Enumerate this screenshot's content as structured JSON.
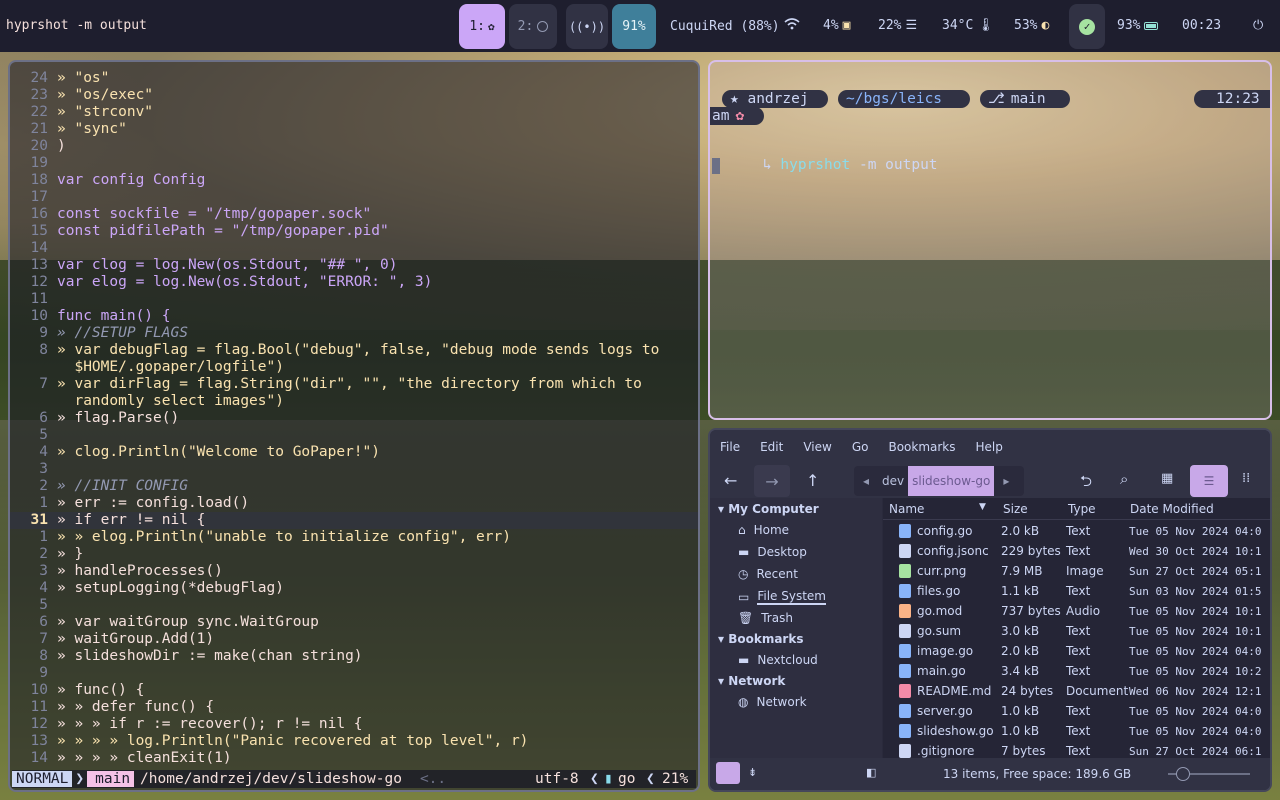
{
  "topbar": {
    "window_title": "hyprshot -m output",
    "ws1": "1:",
    "ws2": "2:",
    "volume": "91%",
    "wifi": "CuquiRed (88%)",
    "cpu": "4%",
    "mem": "22%",
    "temp": "34°C",
    "brightness": "53%",
    "battery": "93%",
    "clock": "00:23"
  },
  "editor": {
    "lines": [
      {
        "n": "24",
        "t": "» \"os\""
      },
      {
        "n": "23",
        "t": "» \"os/exec\""
      },
      {
        "n": "22",
        "t": "» \"strconv\""
      },
      {
        "n": "21",
        "t": "» \"sync\""
      },
      {
        "n": "20",
        "t": ")"
      },
      {
        "n": "19",
        "t": ""
      },
      {
        "n": "18",
        "t": "var config Config"
      },
      {
        "n": "17",
        "t": ""
      },
      {
        "n": "16",
        "t": "const sockfile = \"/tmp/gopaper.sock\""
      },
      {
        "n": "15",
        "t": "const pidfilePath = \"/tmp/gopaper.pid\""
      },
      {
        "n": "14",
        "t": ""
      },
      {
        "n": "13",
        "t": "var clog = log.New(os.Stdout, \"## \", 0)"
      },
      {
        "n": "12",
        "t": "var elog = log.New(os.Stdout, \"ERROR: \", 3)"
      },
      {
        "n": "11",
        "t": ""
      },
      {
        "n": "10",
        "t": "func main() {"
      },
      {
        "n": "9",
        "t": "» //SETUP FLAGS"
      },
      {
        "n": "8",
        "t": "» var debugFlag = flag.Bool(\"debug\", false, \"debug mode sends logs to"
      },
      {
        "n": "",
        "t": "  $HOME/.gopaper/logfile\")"
      },
      {
        "n": "7",
        "t": "» var dirFlag = flag.String(\"dir\", \"\", \"the directory from which to"
      },
      {
        "n": "",
        "t": "  randomly select images\")"
      },
      {
        "n": "6",
        "t": "» flag.Parse()"
      },
      {
        "n": "5",
        "t": ""
      },
      {
        "n": "4",
        "t": "» clog.Println(\"Welcome to GoPaper!\")"
      },
      {
        "n": "3",
        "t": ""
      },
      {
        "n": "2",
        "t": "» //INIT CONFIG"
      },
      {
        "n": "1",
        "t": "» err := config.load()"
      },
      {
        "n": "31",
        "t": "» if err != nil {"
      },
      {
        "n": "1",
        "t": "» » elog.Println(\"unable to initialize config\", err)"
      },
      {
        "n": "2",
        "t": "» }"
      },
      {
        "n": "3",
        "t": "» handleProcesses()"
      },
      {
        "n": "4",
        "t": "» setupLogging(*debugFlag)"
      },
      {
        "n": "5",
        "t": ""
      },
      {
        "n": "6",
        "t": "» var waitGroup sync.WaitGroup"
      },
      {
        "n": "7",
        "t": "» waitGroup.Add(1)"
      },
      {
        "n": "8",
        "t": "» slideshowDir := make(chan string)"
      },
      {
        "n": "9",
        "t": ""
      },
      {
        "n": "10",
        "t": "» func() {"
      },
      {
        "n": "11",
        "t": "» » defer func() {"
      },
      {
        "n": "12",
        "t": "» » » if r := recover(); r != nil {"
      },
      {
        "n": "13",
        "t": "» » » » log.Println(\"Panic recovered at top level\", r)"
      },
      {
        "n": "14",
        "t": "» » » » cleanExit(1)"
      }
    ],
    "status": {
      "mode": "NORMAL",
      "branch": "main",
      "path": "/home/andrzej/dev/slideshow-go",
      "more": "<..",
      "encoding": "utf-8",
      "filetype": "go",
      "percent": "21%"
    }
  },
  "terminal": {
    "user": "★ andrzej",
    "dir": "~/bgs/leics",
    "branch": "main",
    "time": "12:23",
    "ampm": "am",
    "prompt_arrow": "↳",
    "command": "hyprshot",
    "args": " -m output"
  },
  "filemanager": {
    "menu": [
      "File",
      "Edit",
      "View",
      "Go",
      "Bookmarks",
      "Help"
    ],
    "crumb_dev": "dev",
    "crumb_current": "slideshow-go",
    "sidebar": {
      "my_computer": "My Computer",
      "items": [
        "Home",
        "Desktop",
        "Recent",
        "File System",
        "Trash"
      ],
      "bookmarks": "Bookmarks",
      "bookmark_items": [
        "Nextcloud"
      ],
      "network": "Network",
      "network_items": [
        "Network"
      ]
    },
    "columns": [
      "Name",
      "Size",
      "Type",
      "Date Modified"
    ],
    "files": [
      {
        "name": "config.go",
        "size": "2.0 kB",
        "type": "Text",
        "date": "Tue 05 Nov 2024 04:0",
        "icon": "go-file-icon",
        "color": "#89b4fa"
      },
      {
        "name": "config.jsonc",
        "size": "229 bytes",
        "type": "Text",
        "date": "Wed 30 Oct 2024 10:1",
        "icon": "jsonc-file-icon",
        "color": "#cdd6f4"
      },
      {
        "name": "curr.png",
        "size": "7.9 MB",
        "type": "Image",
        "date": "Sun 27 Oct 2024 05:1",
        "icon": "image-file-icon",
        "color": "#a6e3a1"
      },
      {
        "name": "files.go",
        "size": "1.1 kB",
        "type": "Text",
        "date": "Sun 03 Nov 2024 01:5",
        "icon": "go-file-icon",
        "color": "#89b4fa"
      },
      {
        "name": "go.mod",
        "size": "737 bytes",
        "type": "Audio",
        "date": "Tue 05 Nov 2024 10:1",
        "icon": "audio-file-icon",
        "color": "#fab387"
      },
      {
        "name": "go.sum",
        "size": "3.0 kB",
        "type": "Text",
        "date": "Tue 05 Nov 2024 10:1",
        "icon": "text-file-icon",
        "color": "#cdd6f4"
      },
      {
        "name": "image.go",
        "size": "2.0 kB",
        "type": "Text",
        "date": "Tue 05 Nov 2024 04:0",
        "icon": "go-file-icon",
        "color": "#89b4fa"
      },
      {
        "name": "main.go",
        "size": "3.4 kB",
        "type": "Text",
        "date": "Tue 05 Nov 2024 10:2",
        "icon": "go-file-icon",
        "color": "#89b4fa"
      },
      {
        "name": "README.md",
        "size": "24 bytes",
        "type": "Document",
        "date": "Wed 06 Nov 2024 12:1",
        "icon": "markdown-file-icon",
        "color": "#f38ba8"
      },
      {
        "name": "server.go",
        "size": "1.0 kB",
        "type": "Text",
        "date": "Tue 05 Nov 2024 04:0",
        "icon": "go-file-icon",
        "color": "#89b4fa"
      },
      {
        "name": "slideshow.go",
        "size": "1.0 kB",
        "type": "Text",
        "date": "Tue 05 Nov 2024 04:0",
        "icon": "go-file-icon",
        "color": "#89b4fa"
      },
      {
        "name": ".gitignore",
        "size": "7 bytes",
        "type": "Text",
        "date": "Sun 27 Oct 2024 06:1",
        "icon": "text-file-icon",
        "color": "#cdd6f4"
      }
    ],
    "status": "13 items, Free space: 189.6 GB"
  }
}
